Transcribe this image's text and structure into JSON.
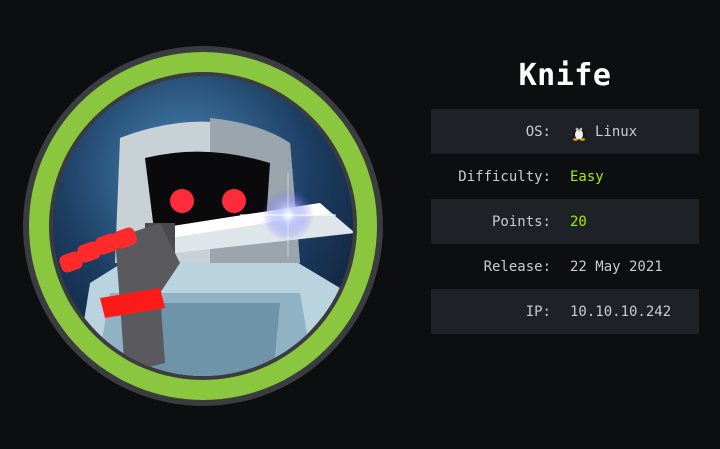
{
  "machine": {
    "name": "Knife",
    "os_label": "OS:",
    "os": "Linux",
    "os_icon": "tux-penguin-icon",
    "difficulty_label": "Difficulty:",
    "difficulty": "Easy",
    "points_label": "Points:",
    "points": "20",
    "release_label": "Release:",
    "release": "22 May 2021",
    "ip_label": "IP:",
    "ip": "10.10.10.242"
  },
  "colors": {
    "background": "#0d0e10",
    "ring": "#8ac73e",
    "accent": "#9fef00",
    "row_shade": "#1e2227",
    "text": "#c9ccd1"
  },
  "avatar_icon": "knife-robot-avatar"
}
